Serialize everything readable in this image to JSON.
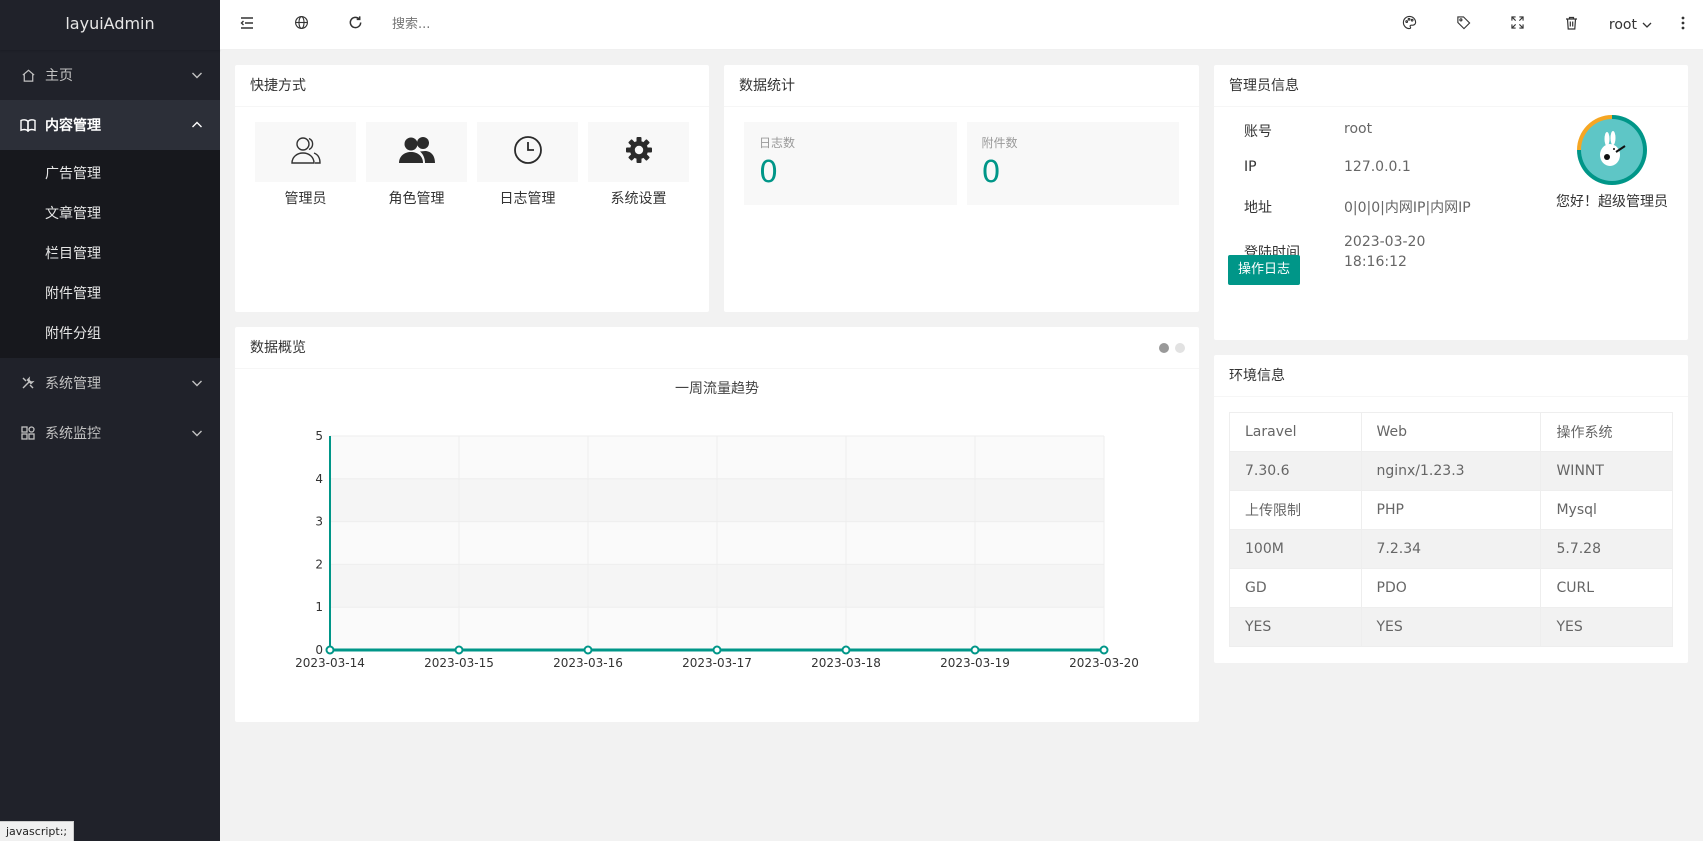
{
  "app": {
    "logo": "layuiAdmin"
  },
  "sidebar": {
    "items": [
      {
        "label": "主页",
        "icon": "home-icon"
      },
      {
        "label": "内容管理",
        "icon": "reader-icon",
        "open": true,
        "children": [
          "广告管理",
          "文章管理",
          "栏目管理",
          "附件管理",
          "附件分组"
        ]
      },
      {
        "label": "系统管理",
        "icon": "tools-icon"
      },
      {
        "label": "系统监控",
        "icon": "app-icon"
      }
    ]
  },
  "statusbar": {
    "text": "javascript:;"
  },
  "header": {
    "search_placeholder": "搜索...",
    "user": "root",
    "left_icons": [
      "shrink-icon",
      "globe-icon",
      "refresh-icon"
    ],
    "right_icons": [
      "theme-icon",
      "note-icon",
      "fullscreen-icon",
      "delete-icon",
      "more-icon"
    ]
  },
  "shortcuts": {
    "title": "快捷方式",
    "items": [
      {
        "label": "管理员",
        "icon": "users-outline-icon"
      },
      {
        "label": "角色管理",
        "icon": "users-solid-icon"
      },
      {
        "label": "日志管理",
        "icon": "clock-icon"
      },
      {
        "label": "系统设置",
        "icon": "gear-icon"
      }
    ]
  },
  "stats": {
    "title": "数据统计",
    "items": [
      {
        "label": "日志数",
        "value": "0"
      },
      {
        "label": "附件数",
        "value": "0"
      }
    ]
  },
  "admin": {
    "title": "管理员信息",
    "rows": [
      {
        "key": "账号",
        "value": "root"
      },
      {
        "key": "IP",
        "value": "127.0.0.1"
      },
      {
        "key": "地址",
        "value": "0|0|0|内网IP|内网IP"
      },
      {
        "key": "登陆时间",
        "value": "2023-03-20",
        "value2": "18:16:12"
      }
    ],
    "greeting": "您好！超级管理员",
    "button": "操作日志"
  },
  "env": {
    "title": "环境信息",
    "rows": [
      [
        "Laravel",
        "Web",
        "操作系统"
      ],
      [
        "7.30.6",
        "nginx/1.23.3",
        "WINNT"
      ],
      [
        "上传限制",
        "PHP",
        "Mysql"
      ],
      [
        "100M",
        "7.2.34",
        "5.7.28"
      ],
      [
        "GD",
        "PDO",
        "CURL"
      ],
      [
        "YES",
        "YES",
        "YES"
      ]
    ]
  },
  "overview": {
    "title": "数据概览"
  },
  "chart_data": {
    "type": "line",
    "title": "一周流量趋势",
    "x": [
      "2023-03-14",
      "2023-03-15",
      "2023-03-16",
      "2023-03-17",
      "2023-03-18",
      "2023-03-19",
      "2023-03-20"
    ],
    "series": [
      {
        "values": [
          0,
          0,
          0,
          0,
          0,
          0,
          0
        ]
      }
    ],
    "ylim": [
      0,
      5
    ],
    "yticks": [
      0,
      1,
      2,
      3,
      4,
      5
    ],
    "grid": true,
    "color": "#009688"
  }
}
